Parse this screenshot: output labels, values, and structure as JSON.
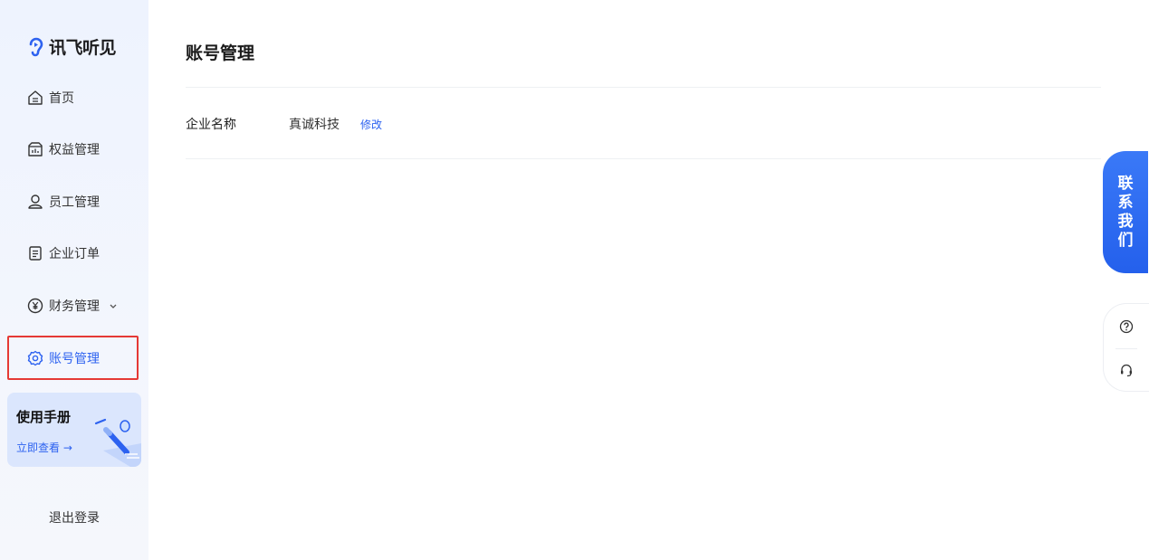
{
  "brand": {
    "name": "讯飞听见",
    "accent": "#2d62f0"
  },
  "sidebar": {
    "items": [
      {
        "label": "首页",
        "icon": "home-icon"
      },
      {
        "label": "权益管理",
        "icon": "benefits-icon"
      },
      {
        "label": "员工管理",
        "icon": "user-icon"
      },
      {
        "label": "企业订单",
        "icon": "order-icon"
      },
      {
        "label": "财务管理",
        "icon": "yen-icon",
        "expandable": true
      },
      {
        "label": "账号管理",
        "icon": "gear-icon",
        "active": true
      }
    ],
    "manual": {
      "title": "使用手册",
      "link": "立即查看 →"
    },
    "logout": "退出登录"
  },
  "main": {
    "title": "账号管理",
    "fields": [
      {
        "label": "企业名称",
        "value": "真诚科技",
        "action": "修改"
      }
    ]
  },
  "float": {
    "contact": [
      "联",
      "系",
      "我",
      "们"
    ],
    "tools": [
      "help-icon",
      "headset-icon"
    ]
  }
}
